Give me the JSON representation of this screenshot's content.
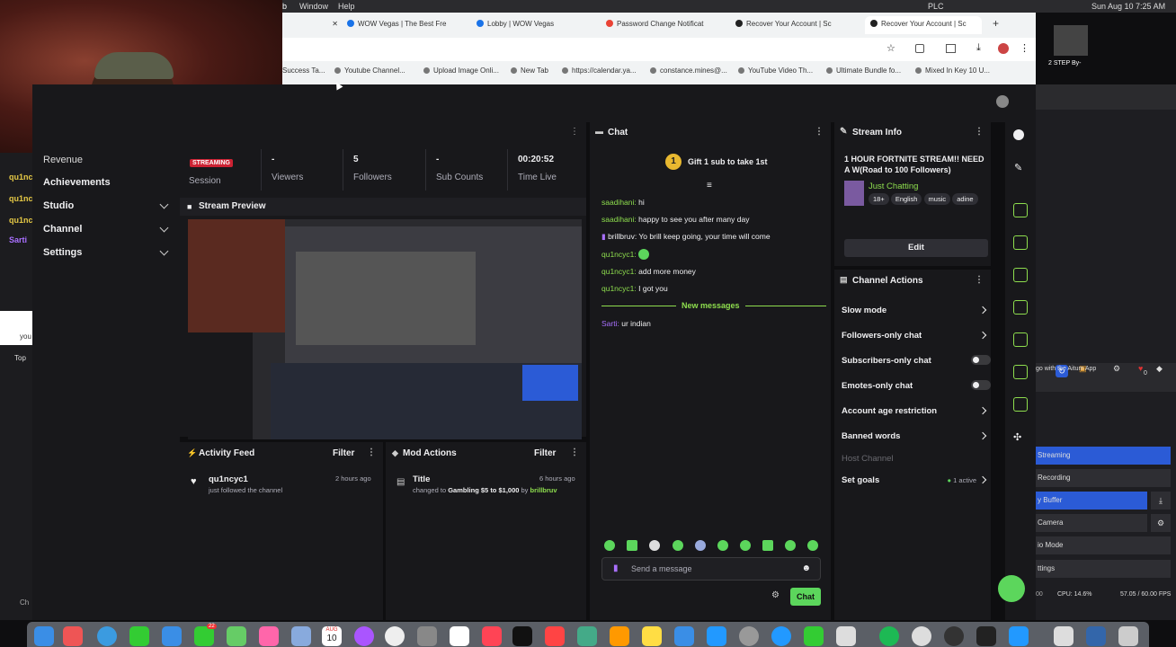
{
  "mac_menu": {
    "window": "Window",
    "help": "Help",
    "flag": "PLC",
    "datetime": "Sun Aug 10  7:25 AM"
  },
  "browser": {
    "tabs": [
      {
        "label": "WOW Vegas | The Best Fre",
        "color": "#1a73e8"
      },
      {
        "label": "Lobby | WOW Vegas",
        "color": "#1a73e8"
      },
      {
        "label": "Password Change Notificat",
        "color": "#ea4335"
      },
      {
        "label": "Recover Your Account | Sc",
        "color": "#222222"
      },
      {
        "label": "Recover Your Account | Sc",
        "color": "#222222"
      }
    ],
    "bookmarks": [
      "Success Ta...",
      "Youtube Channel...",
      "Upload Image Onli...",
      "New Tab",
      "https://calendar.ya...",
      "constance.mines@...",
      "YouTube Video Th...",
      "Ultimate Bundle fo...",
      "Mixed In Key 10 U..."
    ]
  },
  "nav": {
    "items": [
      {
        "label": "Revenue",
        "chevron": false
      },
      {
        "label": "Achievements",
        "chevron": false
      },
      {
        "label": "Studio",
        "chevron": true
      },
      {
        "label": "Channel",
        "chevron": true
      },
      {
        "label": "Settings",
        "chevron": true
      }
    ]
  },
  "leftside": {
    "labels": [
      "qu1nc",
      "qu1nc",
      "qu1nc",
      "Sarti",
      "you",
      "Top",
      "Ch"
    ]
  },
  "stats": {
    "live_badge": "STREAMING",
    "session_label": "Session",
    "viewers_value": "-",
    "viewers_label": "Viewers",
    "followers_value": "5",
    "followers_label": "Followers",
    "subs_value": "-",
    "subs_label": "Sub Counts",
    "time_value": "00:20:52",
    "time_label": "Time Live"
  },
  "stream_preview": {
    "title": "Stream Preview"
  },
  "activity_feed": {
    "title": "Activity Feed",
    "filter": "Filter",
    "items": [
      {
        "user": "qu1ncyc1",
        "text": "just followed the channel",
        "time": "2 hours ago"
      }
    ]
  },
  "mod_actions": {
    "title": "Mod Actions",
    "filter": "Filter",
    "items": [
      {
        "title": "Title",
        "prefix": "changed to",
        "value": "Gambling $5 to $1,000",
        "by": "by",
        "user": "brillbruv",
        "time": "6 hours ago"
      }
    ]
  },
  "chat": {
    "title": "Chat",
    "gift_count": "1",
    "gift_text": "Gift 1 sub to take 1st",
    "messages": [
      {
        "user": "saadihani:",
        "text": "hi",
        "color": "green"
      },
      {
        "user": "saadihani:",
        "text": "happy to see you after many day",
        "color": "green"
      },
      {
        "user": "brillbruv:",
        "text": "Yo brill keep going, your time will come",
        "color": "white"
      },
      {
        "user": "qu1ncyc1:",
        "text": "",
        "color": "green"
      },
      {
        "user": "qu1ncyc1:",
        "text": "add more money",
        "color": "green"
      },
      {
        "user": "qu1ncyc1:",
        "text": "I got you",
        "color": "green"
      }
    ],
    "new_messages": "New messages",
    "after_messages": [
      {
        "user": "Sarti:",
        "text": "ur indian",
        "color": "purple"
      }
    ],
    "input_placeholder": "Send a message",
    "send_label": "Chat"
  },
  "stream_info": {
    "title": "Stream Info",
    "stream_title": "1 HOUR FORTNITE STREAM!! NEED A W(Road to 100 Followers)",
    "category": "Just Chatting",
    "tags": [
      "18+",
      "English",
      "music",
      "adine"
    ],
    "edit_label": "Edit"
  },
  "channel_actions": {
    "title": "Channel Actions",
    "items": [
      {
        "label": "Slow mode",
        "kind": "arrow"
      },
      {
        "label": "Followers-only chat",
        "kind": "arrow"
      },
      {
        "label": "Subscribers-only chat",
        "kind": "toggle"
      },
      {
        "label": "Emotes-only chat",
        "kind": "toggle"
      },
      {
        "label": "Account age restriction",
        "kind": "arrow"
      },
      {
        "label": "Banned words",
        "kind": "arrow"
      }
    ],
    "host_label": "Host Channel",
    "goals_label": "Set goals",
    "goals_status": "1 active"
  },
  "obs": {
    "now_playing": "2 STEP By-",
    "app_text": "go with the Aitum App",
    "counter": "0",
    "buttons": [
      "Streaming",
      "Recording",
      "y Buffer",
      "Camera",
      "io Mode",
      "ttings"
    ],
    "cpu": "CPU: 14.6%",
    "fps": "57.05 / 60.00 FPS",
    "id": "00"
  },
  "dock": {
    "calendar_month": "AUG",
    "calendar_day": "10",
    "notif_badge": "22"
  },
  "colors": {
    "accent_green": "#8ede4e",
    "live_red": "#cc2233",
    "obs_blue": "#2b5bd6",
    "bg": "#18181b"
  }
}
